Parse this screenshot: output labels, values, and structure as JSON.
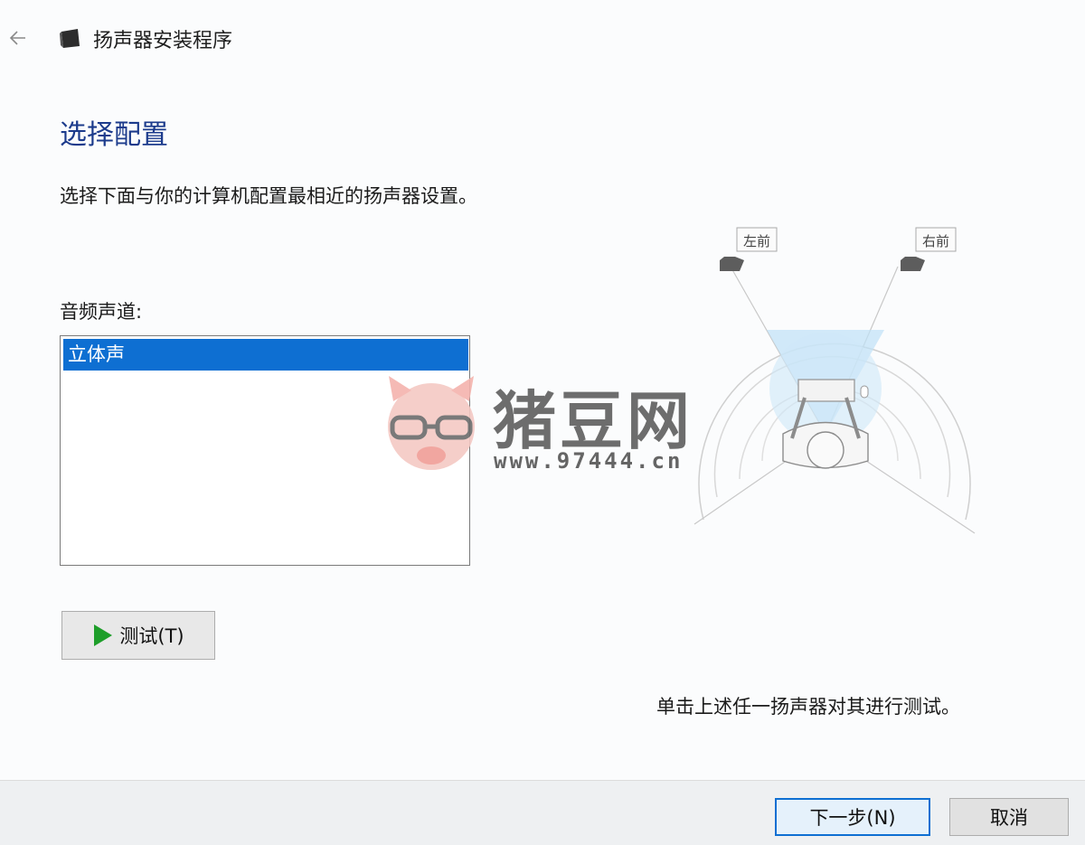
{
  "window": {
    "title": "扬声器安装程序",
    "back_icon": "back-arrow-icon",
    "app_icon": "speaker-icon"
  },
  "page": {
    "heading": "选择配置",
    "instruction": "选择下面与你的计算机配置最相近的扬声器设置。",
    "channel_label": "音频声道:",
    "channels": [
      {
        "label": "立体声",
        "selected": true
      }
    ],
    "test_button_label": "测试(T)",
    "test_button_icon": "play-icon",
    "hint": "单击上述任一扬声器对其进行测试。"
  },
  "diagram": {
    "left_front_label": "左前",
    "right_front_label": "右前"
  },
  "footer": {
    "next_label": "下一步(N)",
    "cancel_label": "取消"
  },
  "watermark": {
    "title": "猪豆网",
    "url": "www.97444.cn"
  },
  "colors": {
    "accent": "#0e6fd2",
    "heading": "#1c3b8c",
    "play": "#1e9e2a"
  }
}
